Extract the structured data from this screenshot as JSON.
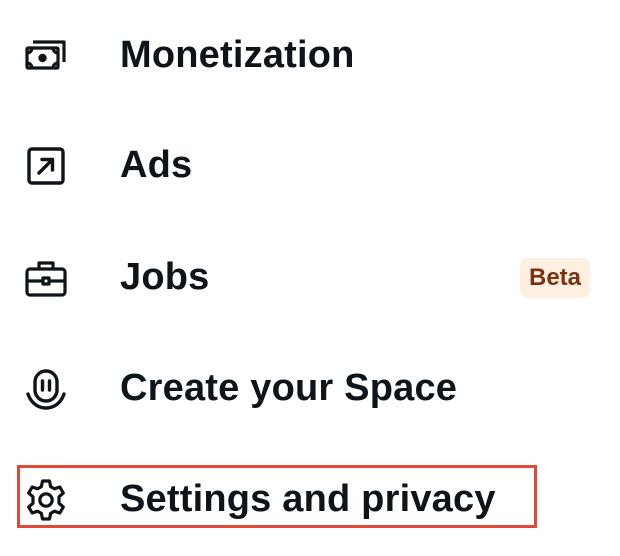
{
  "menu": {
    "items": [
      {
        "label": "Monetization",
        "icon": "monetization-icon"
      },
      {
        "label": "Ads",
        "icon": "arrow-up-right-square-icon"
      },
      {
        "label": "Jobs",
        "icon": "briefcase-icon",
        "badge": "Beta"
      },
      {
        "label": "Create your Space",
        "icon": "spaces-microphone-icon"
      },
      {
        "label": "Settings and privacy",
        "icon": "gear-icon",
        "highlighted": true
      }
    ]
  },
  "colors": {
    "text": "#0f1419",
    "badge_background": "#fdf0e1",
    "badge_text": "#7a3210",
    "highlight_border": "#e04a3b"
  }
}
